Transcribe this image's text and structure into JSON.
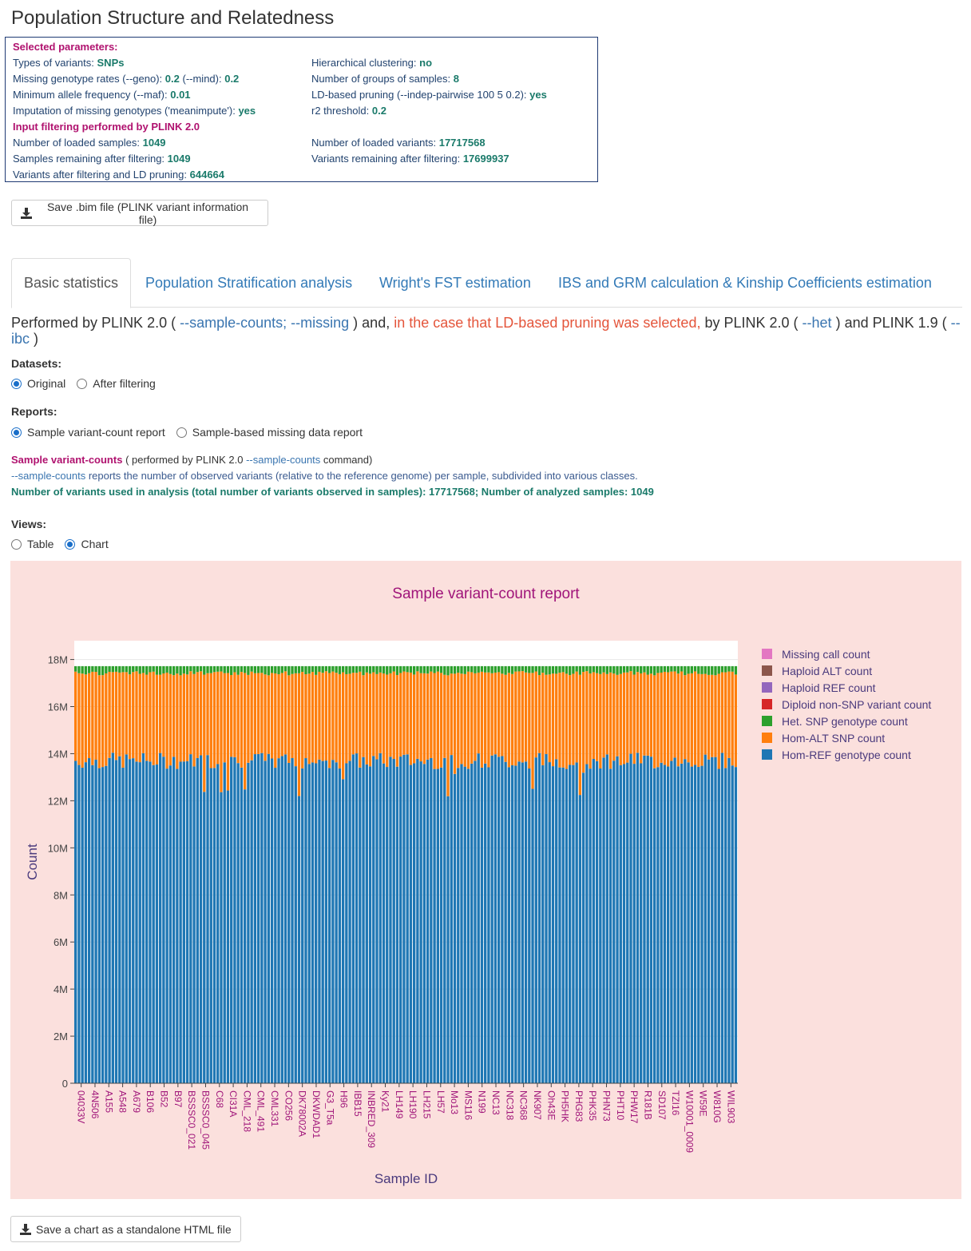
{
  "page": {
    "title": "Population Structure and Relatedness"
  },
  "params": {
    "selected_header": "Selected parameters:",
    "types_label": "Types of variants:",
    "types_value": "SNPs",
    "hier_label": "Hierarchical clustering:",
    "hier_value": "no",
    "missing_label1": "Missing genotype rates (--geno):",
    "geno_value": "0.2",
    "missing_label2": "(--mind):",
    "mind_value": "0.2",
    "groups_label": "Number of groups of samples:",
    "groups_value": "8",
    "maf_label": "Minimum allele frequency (--maf):",
    "maf_value": "0.01",
    "ld_label": "LD-based pruning (--indep-pairwise 100 5 0.2):",
    "ld_value": "yes",
    "imp_label": "Imputation of missing genotypes ('meanimpute'):",
    "imp_value": "yes",
    "r2_label": "r2 threshold:",
    "r2_value": "0.2",
    "input_header": "Input filtering performed by PLINK 2.0",
    "loaded_samples_label": "Number of loaded samples:",
    "loaded_samples_value": "1049",
    "loaded_variants_label": "Number of loaded variants:",
    "loaded_variants_value": "17717568",
    "remaining_samples_label": "Samples remaining after filtering:",
    "remaining_samples_value": "1049",
    "remaining_variants_label": "Variants remaining after filtering:",
    "remaining_variants_value": "17699937",
    "ld_variants_label": "Variants after filtering and LD pruning:",
    "ld_variants_value": "644664"
  },
  "buttons": {
    "save_bim": "Save .bim file (PLINK variant information file)",
    "save_chart": "Save a chart as a standalone HTML file"
  },
  "tabs": [
    "Basic statistics",
    "Population Stratification analysis",
    "Wright's FST estimation",
    "IBS and GRM calculation & Kinship Coefficients estimation"
  ],
  "performed": {
    "p1": "Performed by PLINK 2.0 (",
    "link1": "--sample-counts; --missing",
    "p2": ") and,",
    "warn": "in the case that LD-based pruning was selected,",
    "p3": "by PLINK 2.0 (",
    "link2": "--het",
    "p4": ") and PLINK 1.9 (",
    "link3": "--ibc",
    "p5": ")"
  },
  "datasets": {
    "label": "Datasets:",
    "opt1": "Original",
    "opt2": "After filtering"
  },
  "reports": {
    "label": "Reports:",
    "opt1": "Sample variant-count report",
    "opt2": "Sample-based missing data report"
  },
  "info": {
    "title": "Sample variant-counts",
    "paren1": "( performed by PLINK 2.0",
    "cmd": "--sample-counts",
    "paren2": "command)",
    "desc_cmd": "--sample-counts",
    "desc": "reports the number of observed variants (relative to the reference genome) per sample, subdivided into various classes.",
    "summary": "Number of variants used in analysis (total number of variants observed in samples): 17717568; Number of analyzed samples: 1049"
  },
  "views": {
    "label": "Views:",
    "opt1": "Table",
    "opt2": "Chart"
  },
  "colors": {
    "missing": "#e377c2",
    "haploid_alt": "#8c564b",
    "haploid_ref": "#9467bd",
    "diploid_nonsnp": "#d62728",
    "het": "#2ca02c",
    "hom_alt": "#ff7f0e",
    "hom_ref": "#1f77b4",
    "panel_bg": "#fbe0dd",
    "title_color": "#a0157a",
    "axis_label_color": "#4a3a7d"
  },
  "chart_data": {
    "type": "bar",
    "stacked": true,
    "title": "Sample variant-count report",
    "xlabel": "Sample ID",
    "ylabel": "Count",
    "ylim": [
      0,
      18800000
    ],
    "yticks": [
      "0",
      "2M",
      "4M",
      "6M",
      "8M",
      "10M",
      "12M",
      "14M",
      "16M",
      "18M"
    ],
    "ytick_values": [
      0,
      2000000,
      4000000,
      6000000,
      8000000,
      10000000,
      12000000,
      14000000,
      16000000,
      18000000
    ],
    "legend_position": "right",
    "x_tick_labels": [
      "04033V",
      "4N506",
      "A155",
      "A548",
      "A679",
      "B106",
      "B52",
      "B97",
      "BSSSC0_021",
      "BSSSC0_045",
      "C68",
      "CI31A",
      "CML_218",
      "CML_491",
      "CML331",
      "CO256",
      "DK78002A",
      "DKWDAD1",
      "G3_T5a",
      "H96",
      "IBB15",
      "INBRED_309",
      "Ky21",
      "LH149",
      "LH190",
      "LH215",
      "LH57",
      "Mo13",
      "MS116",
      "N199",
      "NC13",
      "NC318",
      "NC368",
      "NK907",
      "Oh43E",
      "PH5HK",
      "PHG83",
      "PHK35",
      "PHN73",
      "PHT10",
      "PHW17",
      "R181B",
      "SD107",
      "TZI16",
      "W10001_0009",
      "W59E",
      "W810G",
      "WIL903"
    ],
    "series": [
      {
        "name": "Hom-REF genotype count",
        "typical_value": 13700000
      },
      {
        "name": "Hom-ALT SNP count",
        "typical_value": 3700000
      },
      {
        "name": "Het. SNP genotype count",
        "typical_value": 300000
      },
      {
        "name": "Diploid non-SNP variant count",
        "typical_value": 0
      },
      {
        "name": "Haploid REF count",
        "typical_value": 0
      },
      {
        "name": "Haploid ALT count",
        "typical_value": 0
      },
      {
        "name": "Missing call count",
        "typical_value": 0
      }
    ],
    "legend": [
      "Missing call count",
      "Haploid ALT count",
      "Haploid REF count",
      "Diploid non-SNP variant count",
      "Het. SNP genotype count",
      "Hom-ALT SNP count",
      "Hom-REF genotype count"
    ],
    "total_per_sample": 17717568,
    "n_samples": 1049
  }
}
